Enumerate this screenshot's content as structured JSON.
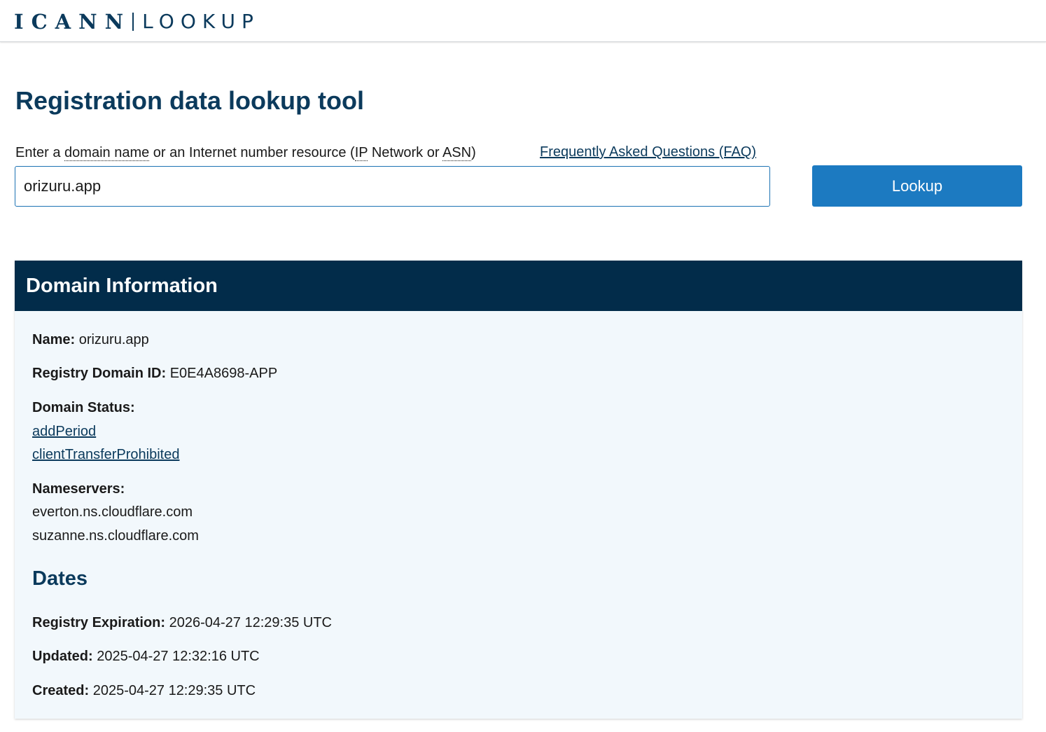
{
  "header": {
    "brand": "ICANN",
    "product": "LOOKUP"
  },
  "page": {
    "title": "Registration data lookup tool"
  },
  "search": {
    "prompt_prefix": "Enter a ",
    "prompt_domain": "domain name",
    "prompt_middle": " or an Internet number resource (",
    "prompt_ip": "IP",
    "prompt_network": " Network or ",
    "prompt_asn": "ASN",
    "prompt_suffix": ")",
    "faq_label": "Frequently Asked Questions (FAQ)",
    "value": "orizuru.app",
    "button_label": "Lookup"
  },
  "domain_info": {
    "heading": "Domain Information",
    "name_label": "Name:",
    "name_value": "orizuru.app",
    "registry_id_label": "Registry Domain ID:",
    "registry_id_value": "E0E4A8698-APP",
    "status_label": "Domain Status:",
    "statuses": [
      "addPeriod",
      "clientTransferProhibited"
    ],
    "nameservers_label": "Nameservers:",
    "nameservers": [
      "everton.ns.cloudflare.com",
      "suzanne.ns.cloudflare.com"
    ]
  },
  "dates": {
    "heading": "Dates",
    "expiration_label": "Registry Expiration:",
    "expiration_value": "2026-04-27 12:29:35 UTC",
    "updated_label": "Updated:",
    "updated_value": "2025-04-27 12:32:16 UTC",
    "created_label": "Created:",
    "created_value": "2025-04-27 12:29:35 UTC"
  },
  "colors": {
    "navy": "#022c4a",
    "accent_blue": "#1c7ac1",
    "title_blue": "#0b3a5c",
    "panel_bg": "#f2f8fc"
  }
}
